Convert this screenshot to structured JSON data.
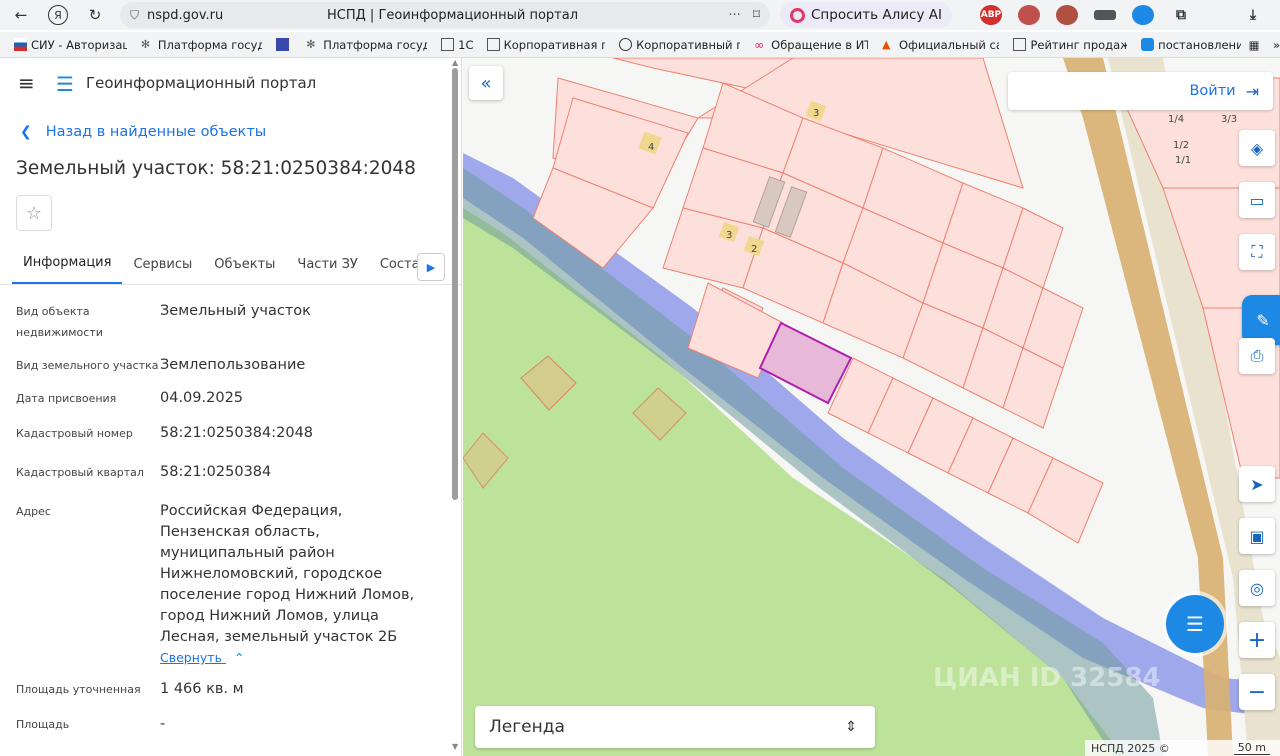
{
  "browser": {
    "url": "nspd.gov.ru",
    "page_title": "НСПД | Геоинформационный портал",
    "alisa_label": "Спросить Алису AI",
    "abp_label": "ABP",
    "bookmarks": [
      "СИУ - Авторизац",
      "Платформа госуд",
      "Платформа госуд",
      "1С",
      "Корпоративная п",
      "Корпоративный п",
      "Обращение в ИТ",
      "Официальный са",
      "Рейтинг продаж",
      "постановлени"
    ],
    "colors": {
      "chrome": "#f2f3f5",
      "alisa_ring": "#e03a6a",
      "abp": "#d32f2f"
    }
  },
  "panel": {
    "title": "Геоинформационный портал",
    "back_label": "Назад в найденные объекты",
    "heading": "Земельный участок: 58:21:0250384:2048",
    "tabs": [
      "Информация",
      "Сервисы",
      "Объекты",
      "Части ЗУ",
      "Соста"
    ],
    "properties": [
      {
        "key": "Вид объекта недвижимости",
        "value": "Земельный участок"
      },
      {
        "key": "Вид земельного участка",
        "value": "Землепользование"
      },
      {
        "key": "Дата присвоения",
        "value": "04.09.2025"
      },
      {
        "key": "Кадастровый номер",
        "value": "58:21:0250384:2048"
      },
      {
        "key": "Кадастровый квартал",
        "value": "58:21:0250384"
      },
      {
        "key": "Адрес",
        "value": "Российская Федерация, Пензенская область, муниципальный район Нижнеломовский, городское поселение город Нижний Ломов, город Нижний Ломов, улица Лесная, земельный участок 2Б"
      },
      {
        "key": "Площадь уточненная",
        "value": "1 466 кв. м"
      },
      {
        "key": "Площадь",
        "value": "-"
      }
    ],
    "collapse_label": "Свернуть",
    "accent": "#1a73e8"
  },
  "map": {
    "login_label": "Войти",
    "legend_label": "Легенда",
    "copyright": "НСПД 2025 ©",
    "scale": "50 m",
    "watermark": "ЦИАН ID 32584",
    "parcel_labels": [
      "4",
      "3",
      "3",
      "2",
      "1/4",
      "1/2",
      "1/1",
      "3/3"
    ],
    "colors": {
      "parcel_border": "#f08070",
      "selected": "#b020b0",
      "green": "#bde29a",
      "river": "#8e9ae8",
      "road": "#d8b070"
    }
  }
}
